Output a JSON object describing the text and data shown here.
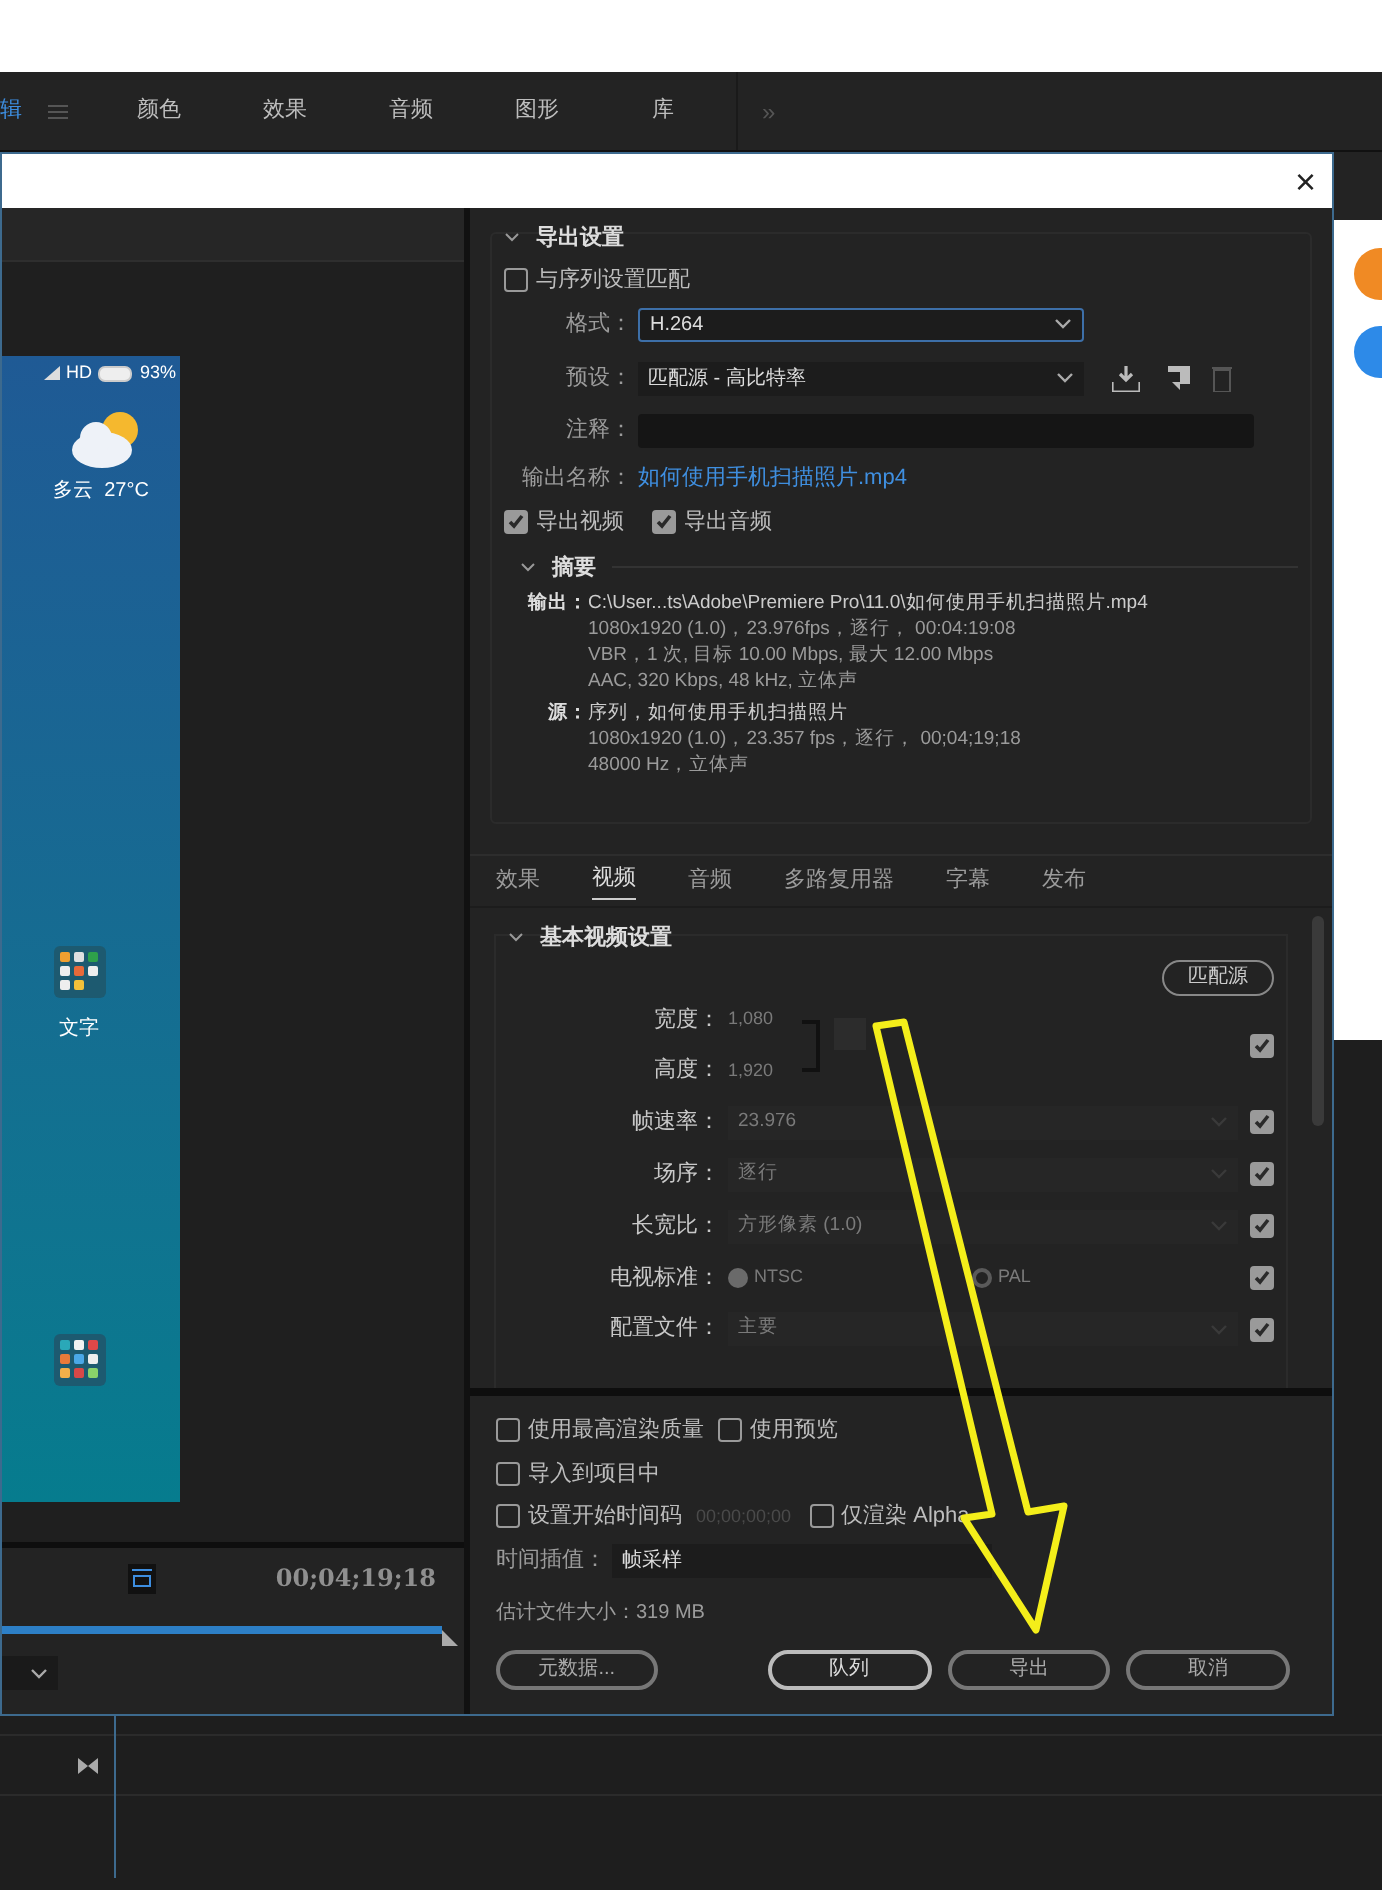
{
  "menu_bar": {
    "items": [
      {
        "label": "辑",
        "selected": true
      },
      {
        "label": "颜色",
        "selected": false
      },
      {
        "label": "效果",
        "selected": false
      },
      {
        "label": "音频",
        "selected": false
      },
      {
        "label": "图形",
        "selected": false
      },
      {
        "label": "库",
        "selected": false
      }
    ],
    "overflow": "»"
  },
  "dialog": {
    "close": "×",
    "preview": {
      "network": "HD",
      "battery": "93%",
      "weather": "多云  27°C",
      "folder_label": "文字",
      "timecode": "00;04;19;18",
      "level": 1
    },
    "export_settings": {
      "title": "导出设置",
      "expanded": true,
      "match_sequence": {
        "label": "与序列设置匹配",
        "checked": false
      },
      "format": {
        "label": "格式：",
        "value": "H.264"
      },
      "preset": {
        "label": "预设：",
        "value": "匹配源 - 高比特率"
      },
      "comment": {
        "label": "注释："
      },
      "output_name": {
        "label": "输出名称：",
        "value": "如何使用手机扫描照片.mp4"
      },
      "export_video": {
        "label": "导出视频",
        "checked": true
      },
      "export_audio": {
        "label": "导出音频",
        "checked": true
      },
      "summary": {
        "title": "摘要",
        "expanded": true,
        "output_label": "输出：",
        "output_lines": [
          "C:\\User...ts\\Adobe\\Premiere Pro\\11.0\\如何使用手机扫描照片.mp4",
          "1080x1920 (1.0)，23.976fps，逐行， 00:04:19:08",
          "VBR，1 次, 目标 10.00 Mbps, 最大 12.00 Mbps",
          "AAC, 320 Kbps, 48  kHz, 立体声"
        ],
        "source_label": "源：",
        "source_lines": [
          "序列，如何使用手机扫描照片",
          "1080x1920 (1.0)，23.357 fps，逐行， 00;04;19;18",
          "48000 Hz，立体声"
        ]
      }
    },
    "tabs": [
      {
        "label": "效果",
        "selected": false
      },
      {
        "label": "视频",
        "selected": true
      },
      {
        "label": "音频",
        "selected": false
      },
      {
        "label": "多路复用器",
        "selected": false
      },
      {
        "label": "字幕",
        "selected": false
      },
      {
        "label": "发布",
        "selected": false
      }
    ],
    "video_settings": {
      "title": "基本视频设置",
      "expanded": true,
      "match_button": "匹配源",
      "rows": [
        {
          "kind": "dimension",
          "label": "宽度：",
          "value": "1,080",
          "label2": "高度：",
          "value2": "1,920",
          "checked": true
        },
        {
          "kind": "select",
          "label": "帧速率：",
          "value": "23.976",
          "checked": true
        },
        {
          "kind": "select",
          "label": "场序：",
          "value": "逐行",
          "checked": true
        },
        {
          "kind": "select",
          "label": "长宽比：",
          "value": "方形像素 (1.0)",
          "checked": true
        },
        {
          "kind": "radio",
          "label": "电视标准：",
          "options": [
            {
              "label": "NTSC",
              "selected": true
            },
            {
              "label": "PAL",
              "selected": false
            }
          ],
          "checked": true
        },
        {
          "kind": "select",
          "label": "配置文件：",
          "value": "主要",
          "checked": true
        }
      ]
    },
    "options": [
      {
        "label": "使用最高渲染质量",
        "checked": false
      },
      {
        "label": "使用预览",
        "checked": false
      },
      {
        "label": "导入到项目中",
        "checked": false
      },
      {
        "label": "设置开始时间码",
        "checked": false,
        "timecode": "00;00;00;00"
      },
      {
        "label": "仅渲染 Alpha",
        "checked": false
      }
    ],
    "interpolation": {
      "label": "时间插值：",
      "value": "帧采样"
    },
    "file_size": "估计文件大小：319 MB",
    "buttons": [
      {
        "label": "元数据...",
        "kind": "left"
      },
      {
        "label": "队列",
        "kind": "primary"
      },
      {
        "label": "导出",
        "kind": "normal"
      },
      {
        "label": "取消",
        "kind": "normal"
      }
    ]
  }
}
